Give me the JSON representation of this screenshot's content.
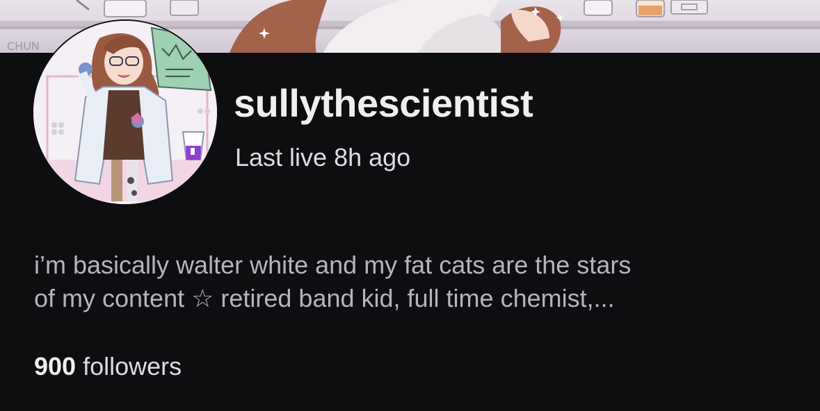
{
  "profile": {
    "banner_watermark": "CHUN",
    "channel_name": "sullythescientist",
    "last_live": "Last live 8h ago",
    "bio_line1": "i’m basically walter white and my fat cats are the stars",
    "bio_line2": "of my content ☆ retired band kid, full time chemist,...",
    "followers_count": "900",
    "followers_label": "followers"
  }
}
